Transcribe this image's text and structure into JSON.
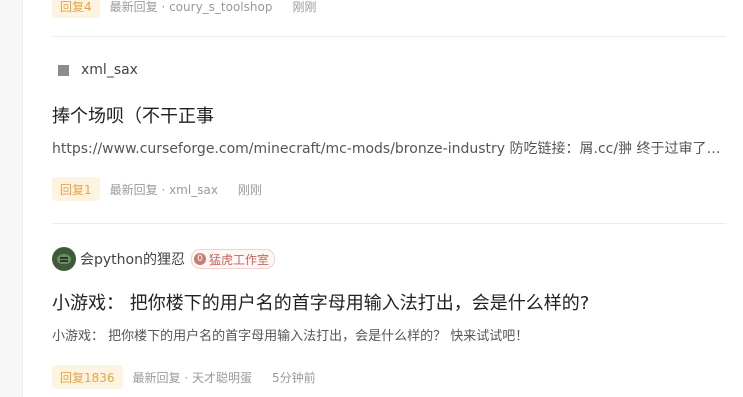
{
  "posts": [
    {
      "reply_label": "回复4",
      "last_reply": "最新回复 · coury_s_toolshop",
      "time": "刚刚"
    },
    {
      "author": "xml_sax",
      "title": "捧个场呗（不干正事",
      "excerpt": "https://www.curseforge.com/minecraft/mc-mods/bronze-industry 防吃链接：屑.cc/翀 终于过审了啊…",
      "reply_label": "回复1",
      "last_reply": "最新回复 · xml_sax",
      "time": "刚刚"
    },
    {
      "author": "会python的狸忍",
      "studio_icon_text": "0",
      "studio_label": "猛虎工作室",
      "title": "小游戏： 把你楼下的用户名的首字母用输入法打出，会是什么样的?",
      "excerpt": "小游戏： 把你楼下的用户名的首字母用输入法打出，会是什么样的？ 快来试试吧！",
      "reply_label": "回复1836",
      "last_reply": "最新回复 · 天才聪明蛋",
      "time": "5分钟前"
    }
  ]
}
